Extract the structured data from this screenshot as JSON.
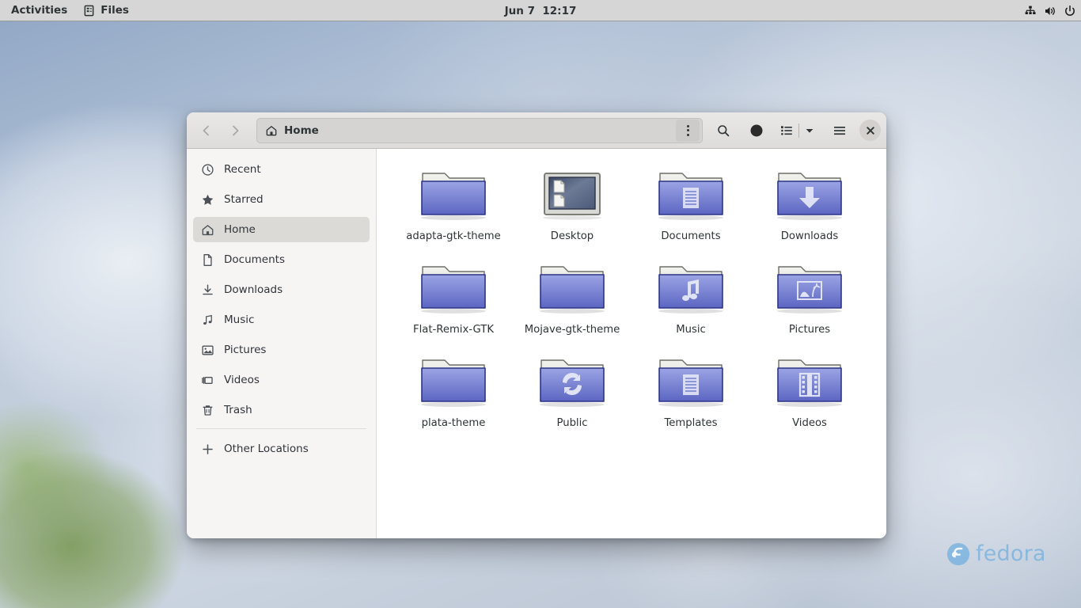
{
  "topbar": {
    "activities_label": "Activities",
    "app_name": "Files",
    "app_icon": "files-icon",
    "clock": "Jun 7  12:17",
    "tray": [
      {
        "name": "network-wired-icon"
      },
      {
        "name": "volume-icon"
      },
      {
        "name": "power-icon"
      }
    ]
  },
  "window": {
    "headerbar": {
      "back_icon": "chevron-left-icon",
      "forward_icon": "chevron-right-icon",
      "path_label": "Home",
      "path_icon": "home-icon",
      "path_menu_icon": "vertical-dots-icon",
      "search_icon": "search-icon",
      "grid_view_icon": "circle-filled-icon",
      "list_view_icon": "list-view-icon",
      "view_dropdown_icon": "chevron-down-icon",
      "main_menu_icon": "hamburger-menu-icon",
      "close_icon": "close-icon"
    },
    "sidebar": {
      "items": [
        {
          "label": "Recent",
          "icon": "clock-icon",
          "selected": false
        },
        {
          "label": "Starred",
          "icon": "star-icon",
          "selected": false
        },
        {
          "label": "Home",
          "icon": "home-icon",
          "selected": true
        },
        {
          "label": "Documents",
          "icon": "document-icon",
          "selected": false
        },
        {
          "label": "Downloads",
          "icon": "download-icon",
          "selected": false
        },
        {
          "label": "Music",
          "icon": "music-icon",
          "selected": false
        },
        {
          "label": "Pictures",
          "icon": "picture-icon",
          "selected": false
        },
        {
          "label": "Videos",
          "icon": "video-icon",
          "selected": false
        },
        {
          "label": "Trash",
          "icon": "trash-icon",
          "selected": false
        }
      ],
      "other_locations": {
        "label": "Other Locations",
        "icon": "plus-icon"
      }
    },
    "files": [
      {
        "name": "adapta-gtk-theme",
        "type": "folder",
        "emblem": "none"
      },
      {
        "name": "Desktop",
        "type": "desktop",
        "emblem": "screen"
      },
      {
        "name": "Documents",
        "type": "folder",
        "emblem": "document"
      },
      {
        "name": "Downloads",
        "type": "folder",
        "emblem": "download-arrow"
      },
      {
        "name": "Flat-Remix-GTK",
        "type": "folder",
        "emblem": "none"
      },
      {
        "name": "Mojave-gtk-theme",
        "type": "folder",
        "emblem": "none"
      },
      {
        "name": "Music",
        "type": "folder",
        "emblem": "music-note"
      },
      {
        "name": "Pictures",
        "type": "folder",
        "emblem": "picture"
      },
      {
        "name": "plata-theme",
        "type": "folder",
        "emblem": "none"
      },
      {
        "name": "Public",
        "type": "folder",
        "emblem": "sync-arrows"
      },
      {
        "name": "Templates",
        "type": "folder",
        "emblem": "document"
      },
      {
        "name": "Videos",
        "type": "folder",
        "emblem": "film"
      }
    ]
  },
  "desktop": {
    "watermark_text": "fedora",
    "watermark_icon": "fedora-logo-icon",
    "watermark_color": "#7ab3df"
  },
  "colors": {
    "topbar_bg": "#d6d6d6",
    "headerbar_bg": "#e4e2e0",
    "sidebar_bg": "#f6f5f4",
    "content_bg": "#ffffff",
    "selection_bg": "#dcdad7",
    "folder_blue": "#6a72c8",
    "text": "#2e3436"
  }
}
